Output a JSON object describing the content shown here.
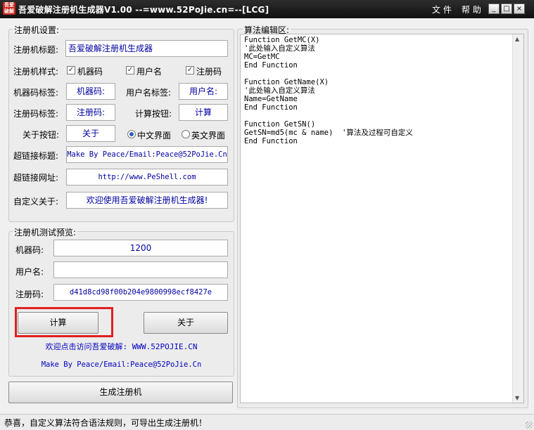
{
  "window": {
    "title": "吾爱破解注册机生成器V1.00  --=www.52PoJie.cn=--[LCG]",
    "icon_text": "吾爱破解",
    "menu": [
      "文 件",
      "帮 助"
    ],
    "controls": {
      "minimize": "_",
      "maximize": "□",
      "close": "×"
    }
  },
  "settings": {
    "group_title": "注册机设置:",
    "title_label": "注册机标题:",
    "title_value": "吾爱破解注册机生成器",
    "style_label": "注册机样式:",
    "checkboxes": [
      {
        "label": "机器码",
        "checked": true
      },
      {
        "label": "用户名",
        "checked": true
      },
      {
        "label": "注册码",
        "checked": true
      }
    ],
    "mc_label": "机器码标签:",
    "mc_value": "机器码:",
    "user_label": "用户名标签:",
    "user_value": "用户名:",
    "sn_label": "注册码标签:",
    "sn_value": "注册码:",
    "calc_label": "计算按钮:",
    "calc_value": "计算",
    "about_label": "关于按钮:",
    "about_value": "关于",
    "radio_cn": "中文界面",
    "radio_en": "英文界面",
    "radio_selected": "cn",
    "link_title_label": "超链接标题:",
    "link_title_value": "Make By Peace/Email:Peace@52PoJie.Cn",
    "link_url_label": "超链接网址:",
    "link_url_value": "http://www.PeShell.com",
    "custom_about_label": "自定义关于:",
    "custom_about_value": "欢迎使用吾爱破解注册机生成器!"
  },
  "preview": {
    "group_title": "注册机测试预览:",
    "mc_label": "机器码:",
    "mc_value": "1200",
    "user_label": "用户名:",
    "user_value": "",
    "sn_label": "注册码:",
    "sn_value": "d41d8cd98f00b204e9800998ecf8427e",
    "calc_button": "计算",
    "about_button": "关于",
    "link1": "欢迎点击访问吾爱破解: WWW.52POJIE.CN",
    "link2": "Make By Peace/Email:Peace@52PoJie.Cn"
  },
  "generate_button": "生成注册机",
  "editor": {
    "group_title": "算法编辑区:",
    "code": "Function GetMC(X)\n'此处输入自定义算法\nMC=GetMC\nEnd Function\n\nFunction GetName(X)\n'此处输入自定义算法\nName=GetName\nEnd Function\n\nFunction GetSN()\nGetSN=md5(mc & name)  '算法及过程可自定义\nEnd Function"
  },
  "status": "恭喜，自定义算法符合语法规则，可导出生成注册机！"
}
